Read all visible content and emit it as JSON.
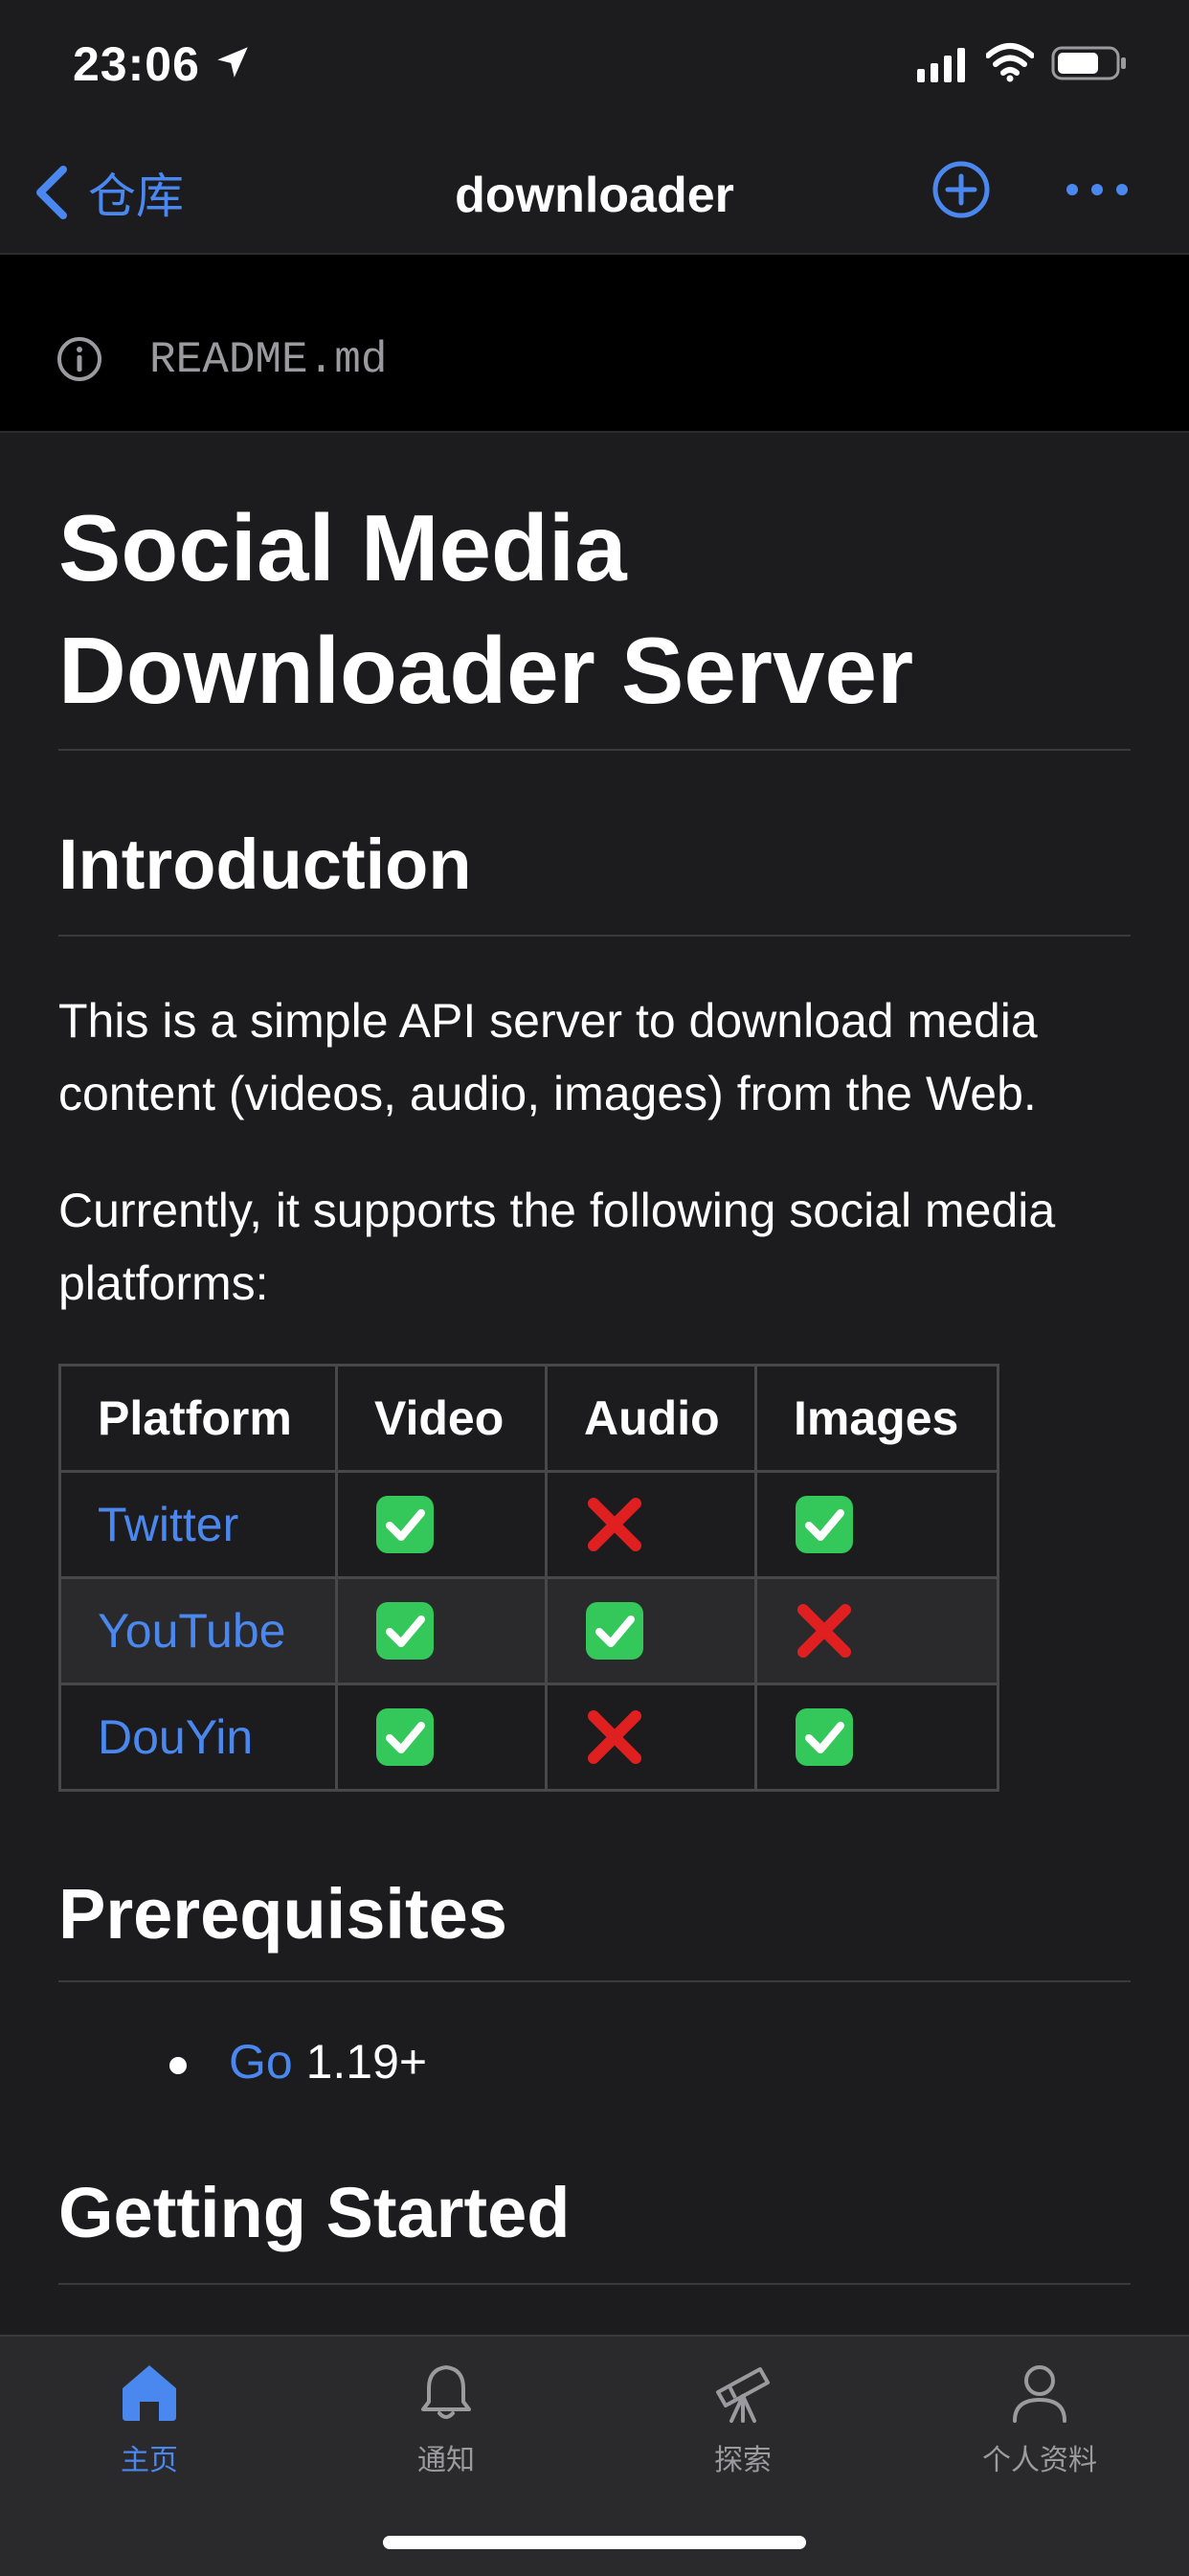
{
  "status_bar": {
    "time": "23:06"
  },
  "nav": {
    "back_label": "仓库",
    "title": "downloader"
  },
  "file": {
    "name": "README.md"
  },
  "readme": {
    "title": "Social Media Downloader Server",
    "intro_heading": "Introduction",
    "intro_text": "This is a simple API server to download media content (videos, audio, images) from the Web.",
    "support_text": "Currently, it supports the following social media platforms:",
    "table": {
      "headers": [
        "Platform",
        "Video",
        "Audio",
        "Images"
      ],
      "rows": [
        {
          "platform": "Twitter",
          "video": true,
          "audio": false,
          "images": true
        },
        {
          "platform": "YouTube",
          "video": true,
          "audio": true,
          "images": false
        },
        {
          "platform": "DouYin",
          "video": true,
          "audio": false,
          "images": true
        }
      ]
    },
    "prereq_heading": "Prerequisites",
    "prereq_link": "Go",
    "prereq_version": " 1.19+",
    "getting_started_heading": "Getting Started"
  },
  "tabs": [
    {
      "label": "主页",
      "icon": "home-icon",
      "active": true
    },
    {
      "label": "通知",
      "icon": "bell-icon",
      "active": false
    },
    {
      "label": "探索",
      "icon": "telescope-icon",
      "active": false
    },
    {
      "label": "个人资料",
      "icon": "person-icon",
      "active": false
    }
  ],
  "colors": {
    "accent": "#4a88f0",
    "background": "#1c1c1e",
    "check": "#34c759",
    "cross": "#e02020"
  }
}
